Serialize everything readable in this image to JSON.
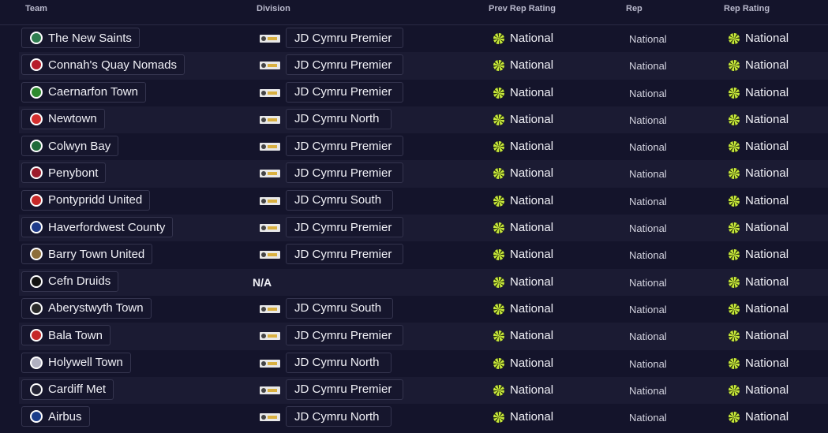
{
  "columns": {
    "team": "Team",
    "division": "Division",
    "prev_rep_rating": "Prev Rep Rating",
    "rep": "Rep",
    "rep_rating": "Rep Rating"
  },
  "colors": {
    "background": "#14142b",
    "row_alt": "#1b1b33",
    "rating_icon": "#c7e83a"
  },
  "rows": [
    {
      "team": "The New Saints",
      "crest": "#2e7d4f",
      "division": "JD Cymru Premier",
      "prev_rep_rating": "National",
      "rep": "National",
      "rep_rating": "National"
    },
    {
      "team": "Connah's Quay Nomads",
      "crest": "#b71c2a",
      "division": "JD Cymru Premier",
      "prev_rep_rating": "National",
      "rep": "National",
      "rep_rating": "National"
    },
    {
      "team": "Caernarfon Town",
      "crest": "#2e8b2e",
      "division": "JD Cymru Premier",
      "prev_rep_rating": "National",
      "rep": "National",
      "rep_rating": "National"
    },
    {
      "team": "Newtown",
      "crest": "#d32f2f",
      "division": "JD Cymru North",
      "prev_rep_rating": "National",
      "rep": "National",
      "rep_rating": "National"
    },
    {
      "team": "Colwyn Bay",
      "crest": "#1f6b3a",
      "division": "JD Cymru Premier",
      "prev_rep_rating": "National",
      "rep": "National",
      "rep_rating": "National"
    },
    {
      "team": "Penybont",
      "crest": "#9c1b2b",
      "division": "JD Cymru Premier",
      "prev_rep_rating": "National",
      "rep": "National",
      "rep_rating": "National"
    },
    {
      "team": "Pontypridd United",
      "crest": "#c62828",
      "division": "JD Cymru South",
      "prev_rep_rating": "National",
      "rep": "National",
      "rep_rating": "National"
    },
    {
      "team": "Haverfordwest County",
      "crest": "#1e3a8a",
      "division": "JD Cymru Premier",
      "prev_rep_rating": "National",
      "rep": "National",
      "rep_rating": "National"
    },
    {
      "team": "Barry Town United",
      "crest": "#8d6e3a",
      "division": "JD Cymru Premier",
      "prev_rep_rating": "National",
      "rep": "National",
      "rep_rating": "National"
    },
    {
      "team": "Cefn Druids",
      "crest": "#111111",
      "division": "N/A",
      "prev_rep_rating": "National",
      "rep": "National",
      "rep_rating": "National"
    },
    {
      "team": "Aberystwyth Town",
      "crest": "#2a2a2a",
      "division": "JD Cymru South",
      "prev_rep_rating": "National",
      "rep": "National",
      "rep_rating": "National"
    },
    {
      "team": "Bala Town",
      "crest": "#c62828",
      "division": "JD Cymru Premier",
      "prev_rep_rating": "National",
      "rep": "National",
      "rep_rating": "National"
    },
    {
      "team": "Holywell Town",
      "crest": "#b0b0c0",
      "division": "JD Cymru North",
      "prev_rep_rating": "National",
      "rep": "National",
      "rep_rating": "National"
    },
    {
      "team": "Cardiff Met",
      "crest": "#222233",
      "division": "JD Cymru Premier",
      "prev_rep_rating": "National",
      "rep": "National",
      "rep_rating": "National"
    },
    {
      "team": "Airbus",
      "crest": "#1a3c8a",
      "division": "JD Cymru North",
      "prev_rep_rating": "National",
      "rep": "National",
      "rep_rating": "National"
    }
  ]
}
